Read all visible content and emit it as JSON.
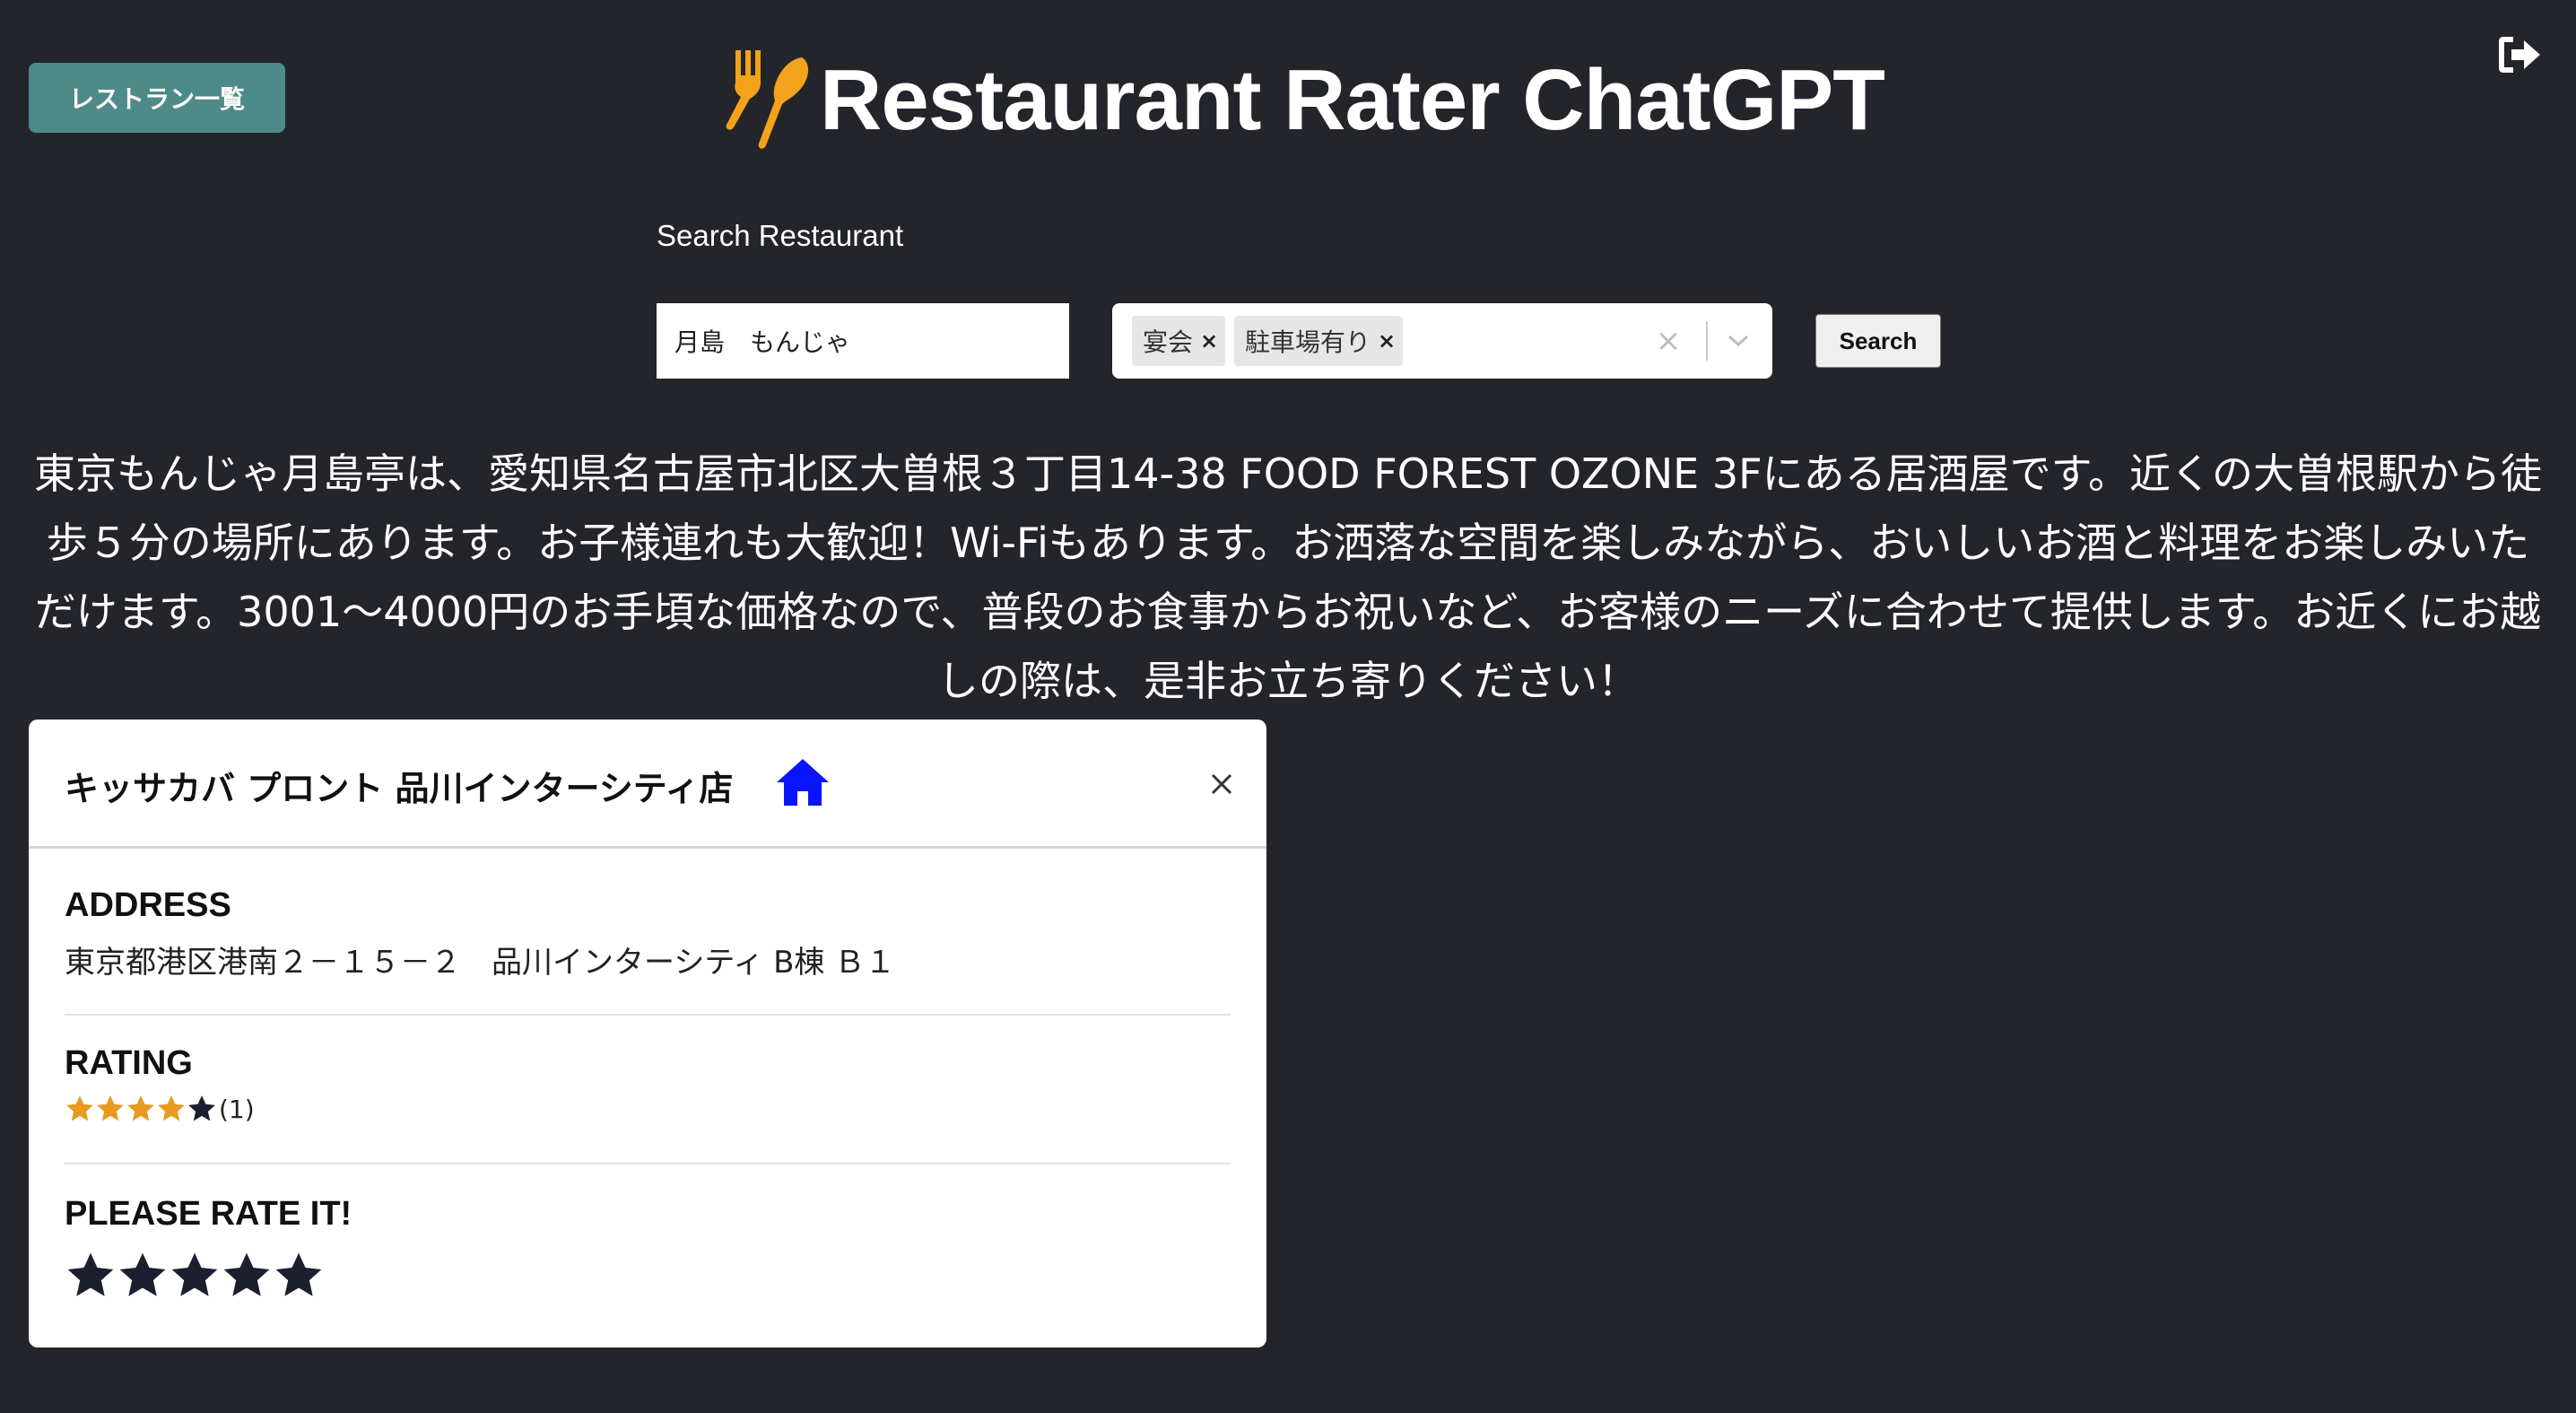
{
  "header": {
    "list_button": "レストラン一覧",
    "title": "Restaurant Rater ChatGPT",
    "logo_icon": "fork-knife-icon",
    "logout_icon": "sign-out-icon"
  },
  "search": {
    "label": "Search Restaurant",
    "keyword_value": "月島　もんじゃ",
    "tags": [
      "宴会",
      "駐車場有り"
    ],
    "button": "Search"
  },
  "description": "東京もんじゃ月島亭は、愛知県名古屋市北区大曽根３丁目14-38 FOOD FOREST OZONE 3Fにある居酒屋です。近くの大曽根駅から徒歩５分の場所にあります。お子様連れも大歓迎！Wi-Fiもあります。お洒落な空間を楽しみながら、おいしいお酒と料理をお楽しみいただけます。3001～4000円のお手頃な価格なので、普段のお食事からお祝いなど、お客様のニーズに合わせて提供します。お近くにお越しの際は、是非お立ち寄りください！",
  "card": {
    "title": "キッサカバ プロント 品川インターシティ店",
    "address_label": "ADDRESS",
    "address": "東京都港区港南２－１５－２　品川インターシティ B棟 Ｂ１",
    "rating_label": "RATING",
    "rating_stars": 4,
    "rating_max": 5,
    "rating_count": "(1)",
    "rate_label": "PLEASE RATE IT!",
    "rate_stars": 5
  },
  "colors": {
    "background": "#23252b",
    "accent": "#4e8a8a",
    "logo": "#f2a31b",
    "star_filled": "#e89a1e",
    "home_icon": "#0a14ff"
  }
}
